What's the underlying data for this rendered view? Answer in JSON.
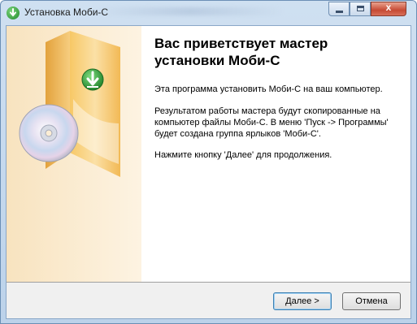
{
  "window": {
    "title": "Установка Моби-С",
    "close_glyph": "x"
  },
  "content": {
    "heading": "Вас приветствует мастер установки Моби-С",
    "paragraph1": "Эта программа установить Моби-С на ваш компьютер.",
    "paragraph2": "Результатом работы мастера будут скопированные на компьютер файлы Моби-С. В меню 'Пуск -> Программы' будет создана группа ярлыков 'Моби-С'.",
    "paragraph3": "Нажмите кнопку 'Далее' для продолжения."
  },
  "buttons": {
    "next_label": "Далее >",
    "cancel_label": "Отмена"
  },
  "colors": {
    "sidebar": "#fbedd4",
    "box": "#f0b64a",
    "download_icon": "#2e9a36"
  }
}
